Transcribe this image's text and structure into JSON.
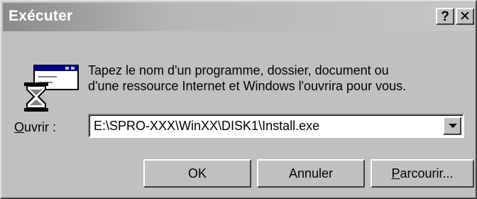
{
  "window": {
    "title": "Exécuter",
    "help_button": "?",
    "close_button": "✕"
  },
  "prompt": {
    "line1": "Tapez le nom d'un programme, dossier, document ou",
    "line2": "d'une ressource Internet et Windows l'ouvrira pour vous."
  },
  "open": {
    "label_mnemonic": "O",
    "label_rest": "uvrir :",
    "value": "E:\\SPRO-XXX\\WinXX\\DISK1\\Install.exe"
  },
  "buttons": {
    "ok": "OK",
    "cancel": "Annuler",
    "browse_mnemonic": "P",
    "browse_rest": "arcourir..."
  },
  "icons": {
    "run": "run-program-hourglass-icon",
    "dropdown": "chevron-down-icon"
  }
}
